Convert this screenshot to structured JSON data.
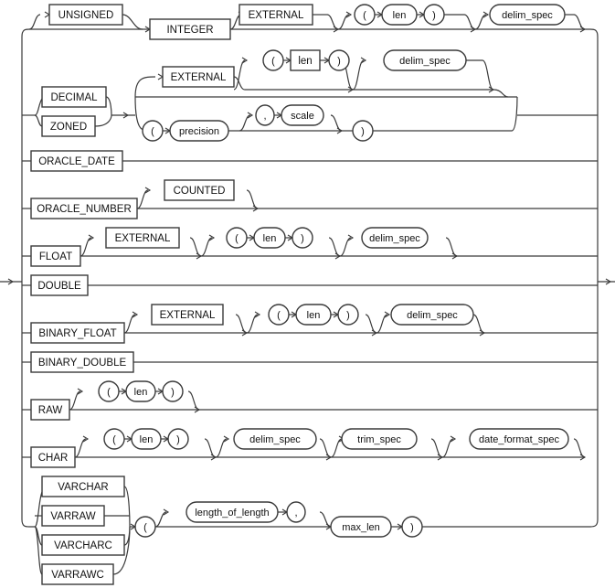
{
  "diagram": {
    "type": "railroad-syntax",
    "rows": [
      {
        "name": "integer",
        "items": [
          "UNSIGNED",
          "INTEGER",
          "EXTERNAL",
          "(",
          "len",
          ")",
          "delim_spec"
        ]
      },
      {
        "name": "decimal",
        "items": [
          "DECIMAL",
          "ZONED",
          "EXTERNAL",
          "(",
          "len",
          ")",
          "delim_spec",
          "(",
          "precision",
          ",",
          "scale",
          ")"
        ]
      },
      {
        "name": "oracle-date",
        "items": [
          "ORACLE_DATE"
        ]
      },
      {
        "name": "oracle-number",
        "items": [
          "ORACLE_NUMBER",
          "COUNTED"
        ]
      },
      {
        "name": "float",
        "items": [
          "FLOAT",
          "EXTERNAL",
          "(",
          "len",
          ")",
          "delim_spec"
        ]
      },
      {
        "name": "double",
        "items": [
          "DOUBLE"
        ]
      },
      {
        "name": "binary-float",
        "items": [
          "BINARY_FLOAT",
          "EXTERNAL",
          "(",
          "len",
          ")",
          "delim_spec"
        ]
      },
      {
        "name": "binary-double",
        "items": [
          "BINARY_DOUBLE"
        ]
      },
      {
        "name": "raw",
        "items": [
          "RAW",
          "(",
          "len",
          ")"
        ]
      },
      {
        "name": "char",
        "items": [
          "CHAR",
          "(",
          "len",
          ")",
          "delim_spec",
          "trim_spec",
          "date_format_spec"
        ]
      },
      {
        "name": "varchar",
        "items": [
          "VARCHAR",
          "VARRAW",
          "VARCHARC",
          "VARRAWC",
          "(",
          "length_of_length",
          ",",
          "max_len",
          ")"
        ]
      }
    ]
  },
  "labels": {
    "unsigned": "UNSIGNED",
    "integer": "INTEGER",
    "external": "EXTERNAL",
    "lparen": "(",
    "rparen": ")",
    "len": "len",
    "delim_spec": "delim_spec",
    "decimal": "DECIMAL",
    "zoned": "ZONED",
    "precision": "precision",
    "comma": ",",
    "scale": "scale",
    "oracle_date": "ORACLE_DATE",
    "oracle_number": "ORACLE_NUMBER",
    "counted": "COUNTED",
    "float": "FLOAT",
    "double": "DOUBLE",
    "binary_float": "BINARY_FLOAT",
    "binary_double": "BINARY_DOUBLE",
    "raw": "RAW",
    "char": "CHAR",
    "trim_spec": "trim_spec",
    "date_format_spec": "date_format_spec",
    "varchar": "VARCHAR",
    "varraw": "VARRAW",
    "varcharc": "VARCHARC",
    "varrawc": "VARRAWC",
    "length_of_length": "length_of_length",
    "max_len": "max_len"
  }
}
